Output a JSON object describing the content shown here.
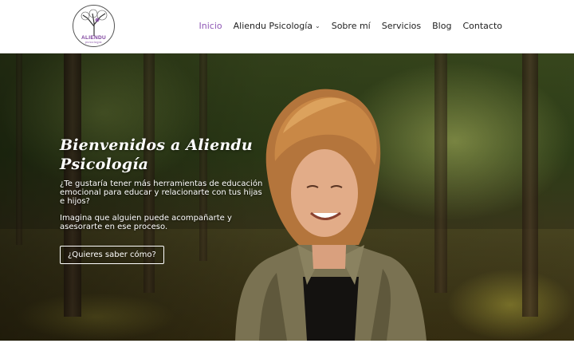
{
  "header": {
    "logo": {
      "name": "ALIENDU",
      "sub": "psicología"
    },
    "nav": [
      {
        "label": "Inicio",
        "active": true
      },
      {
        "label": "Aliendu Psicología",
        "dropdown": true
      },
      {
        "label": "Sobre mí"
      },
      {
        "label": "Servicios"
      },
      {
        "label": "Blog"
      },
      {
        "label": "Contacto"
      }
    ],
    "accent_color": "#8f58b5"
  },
  "hero": {
    "title_line1": "Bienvenidos a Aliendu",
    "title_line2": "Psicología",
    "paragraph1": "¿Te gustaría tener más herramientas de educación emocional para educar y relacionarte con tus hijas e hijos?",
    "paragraph2": "Imagina que alguien puede acompañarte y asesorarte en ese proceso.",
    "cta_label": "¿Quieres saber cómo?"
  },
  "icons": {
    "dropdown": "chevron-down-icon",
    "logo": "tree-logo-icon"
  }
}
